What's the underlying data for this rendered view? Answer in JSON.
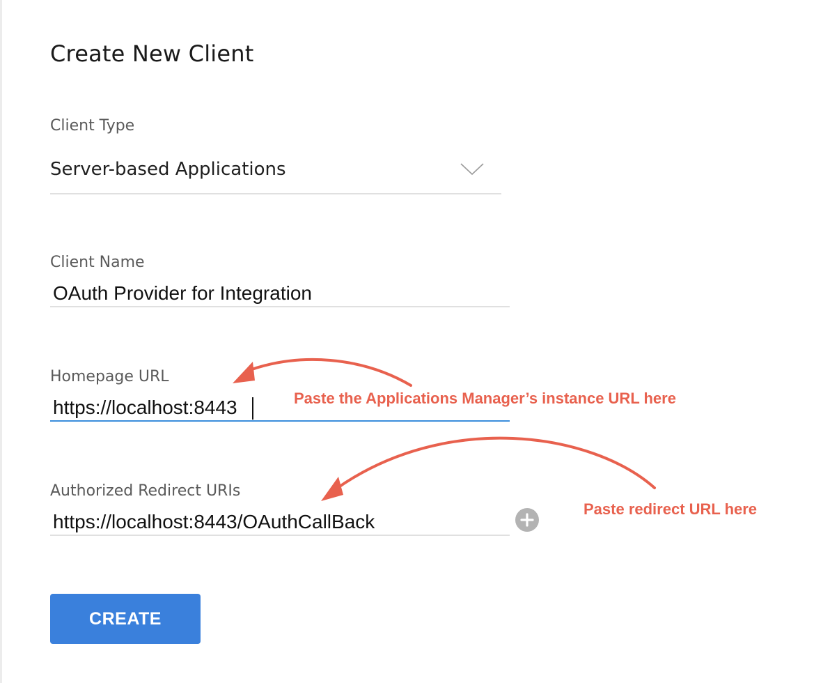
{
  "page": {
    "title": "Create New Client"
  },
  "client_type": {
    "label": "Client Type",
    "selected": "Server-based Applications"
  },
  "client_name": {
    "label": "Client Name",
    "value": "OAuth Provider for Integration"
  },
  "homepage_url": {
    "label": "Homepage URL",
    "value": "https://localhost:8443"
  },
  "redirect_uris": {
    "label": "Authorized Redirect URIs",
    "value": "https://localhost:8443/OAuthCallBack"
  },
  "actions": {
    "create_label": "CREATE"
  },
  "annotations": {
    "homepage_hint": "Paste the Applications Manager’s instance URL here",
    "redirect_hint": "Paste redirect URL here"
  },
  "colors": {
    "accent": "#3a80dc",
    "focus_underline": "#3a8ddc",
    "annotation": "#e8614e",
    "label_text": "#5a5a5a",
    "add_icon": "#b3b3b3"
  },
  "icons": {
    "dropdown": "chevron-down-icon",
    "add": "plus-circle-icon"
  }
}
